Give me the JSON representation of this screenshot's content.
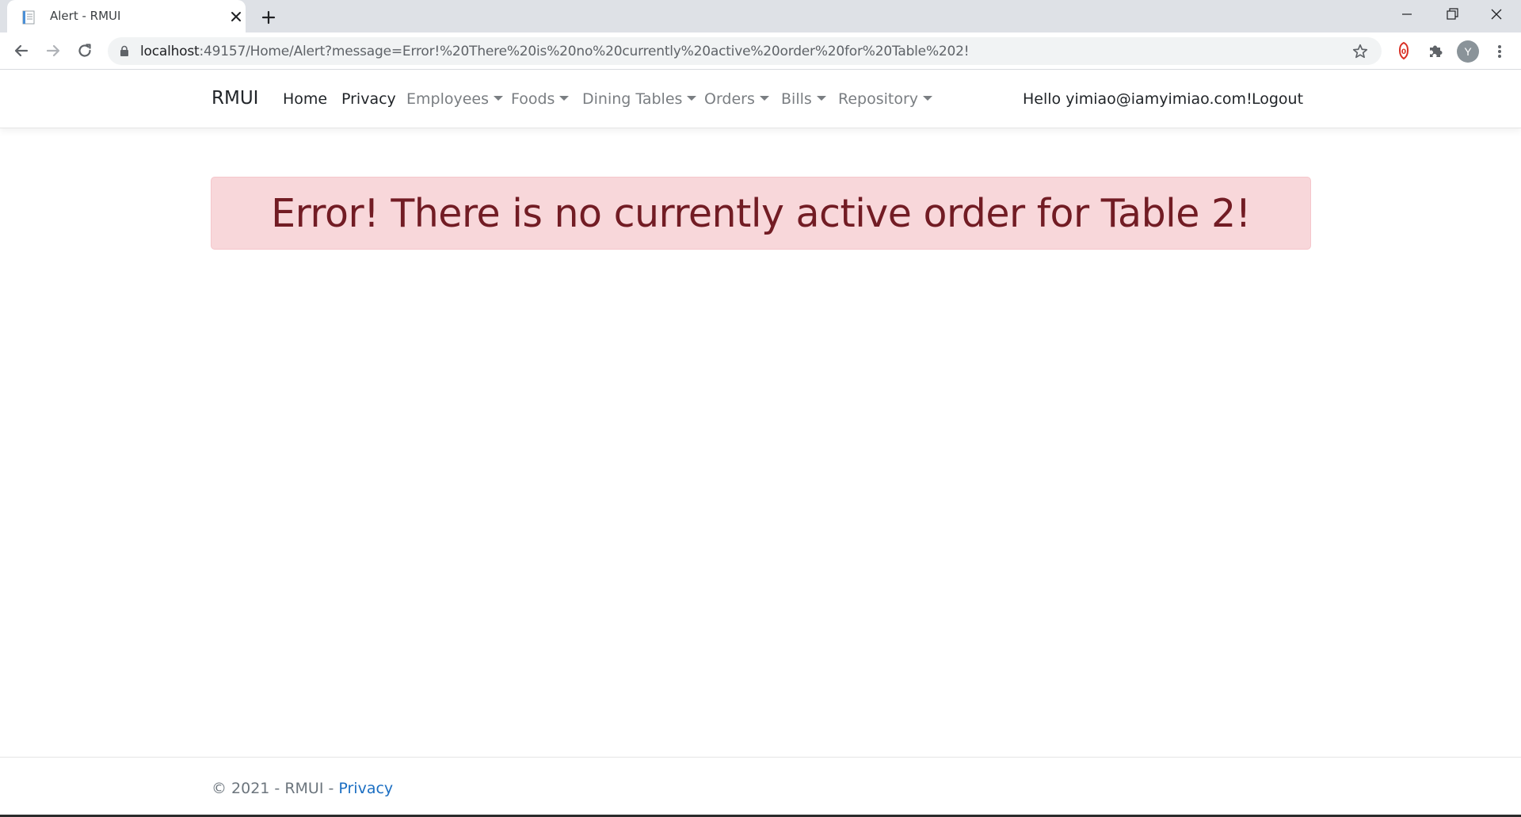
{
  "browser": {
    "tab_title": "Alert - RMUI",
    "url_host": "localhost",
    "url_rest": ":49157/Home/Alert?message=Error!%20There%20is%20no%20currently%20active%20order%20for%20Table%202!",
    "profile_initial": "Y",
    "icons": [
      "favicon",
      "tab-close-icon",
      "new-tab-icon",
      "back-arrow-icon",
      "forward-arrow-icon",
      "reload-icon",
      "lock-icon",
      "star-icon",
      "extension-shield-icon",
      "puzzle-icon",
      "menu-dots-icon",
      "minimize-icon",
      "maximize-icon",
      "close-icon"
    ]
  },
  "navbar": {
    "brand": "RMUI",
    "links": {
      "home": "Home",
      "privacy": "Privacy",
      "employees": "Employees",
      "foods": "Foods",
      "dining_tables": "Dining Tables",
      "orders": "Orders",
      "bills": "Bills",
      "repository": "Repository"
    },
    "greeting": "Hello yimiao@iamyimiao.com!",
    "logout": "Logout"
  },
  "alert": {
    "message": "Error! There is no currently active order for Table 2!",
    "background": "#f8d7da",
    "text_color": "#721c24"
  },
  "footer": {
    "copyright": "© 2021 - RMUI - ",
    "privacy_link": "Privacy",
    "link_color": "#1b6ec2"
  }
}
